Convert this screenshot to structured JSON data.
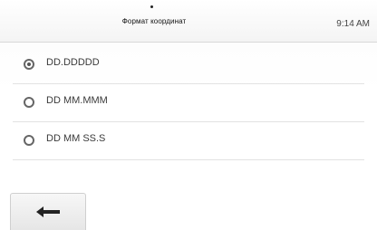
{
  "header": {
    "title": "Формат координат",
    "clock": "9:14 AM"
  },
  "options": [
    {
      "label": "DD.DDDDD",
      "selected": true
    },
    {
      "label": "DD MM.MMM",
      "selected": false
    },
    {
      "label": "DD MM SS.S",
      "selected": false
    }
  ],
  "footer": {
    "back_icon": "left-arrow-icon"
  }
}
